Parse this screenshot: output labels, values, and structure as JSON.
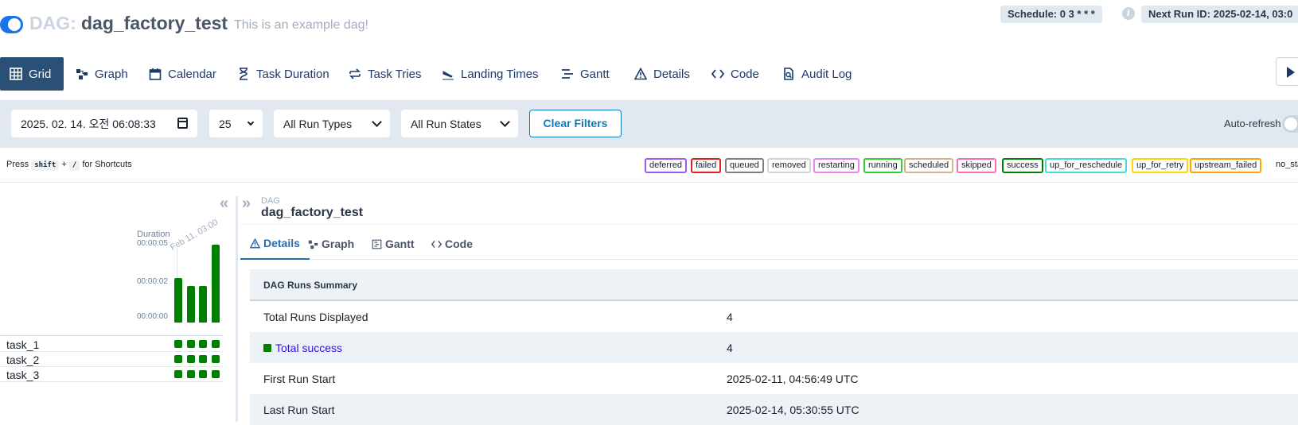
{
  "header": {
    "dag_label": "DAG:",
    "dag_name": "dag_factory_test",
    "description": "This is an example dag!",
    "schedule": "Schedule: 0 3 * * *",
    "next_run": "Next Run ID: 2025-02-14, 03:0",
    "info_glyph": "i"
  },
  "nav": {
    "tabs": [
      {
        "label": "Grid",
        "icon": "grid-icon"
      },
      {
        "label": "Graph",
        "icon": "graph-icon"
      },
      {
        "label": "Calendar",
        "icon": "calendar-icon"
      },
      {
        "label": "Task Duration",
        "icon": "hourglass-icon"
      },
      {
        "label": "Task Tries",
        "icon": "retry-icon"
      },
      {
        "label": "Landing Times",
        "icon": "landing-icon"
      },
      {
        "label": "Gantt",
        "icon": "gantt-icon"
      },
      {
        "label": "Details",
        "icon": "warning-icon"
      },
      {
        "label": "Code",
        "icon": "code-icon"
      },
      {
        "label": "Audit Log",
        "icon": "audit-icon"
      }
    ],
    "active": "Grid"
  },
  "filters": {
    "date": "2025. 02. 14. 오전 06:08:33",
    "limit": "25",
    "run_types": "All Run Types",
    "run_states": "All Run States",
    "clear": "Clear Filters",
    "autorefresh": "Auto-refresh"
  },
  "shortcut": {
    "press": "Press",
    "key1": "shift",
    "plus": "+",
    "key2": "/",
    "suffix": "for Shortcuts"
  },
  "legend": [
    {
      "label": "deferred",
      "color": "#9b59f5"
    },
    {
      "label": "failed",
      "color": "#e02020"
    },
    {
      "label": "queued",
      "color": "#808080"
    },
    {
      "label": "removed",
      "color": "#d3d3d3"
    },
    {
      "label": "restarting",
      "color": "#ee82ee"
    },
    {
      "label": "running",
      "color": "#32cd32"
    },
    {
      "label": "scheduled",
      "color": "#d2b48c"
    },
    {
      "label": "skipped",
      "color": "#ff69b4"
    },
    {
      "label": "success",
      "color": "#008000"
    },
    {
      "label": "up_for_reschedule",
      "color": "#40e0d0"
    },
    {
      "label": "up_for_retry",
      "color": "#ffd700"
    },
    {
      "label": "upstream_failed",
      "color": "#ffa500"
    }
  ],
  "legend_nostatus": "no_sta",
  "grid": {
    "duration_label": "Duration",
    "date_label": "Feb 11, 03:00",
    "ticks": [
      "00:00:05",
      "00:00:02",
      "00:00:00"
    ],
    "run_durations_sec": [
      3.0,
      2.5,
      2.5,
      5.3
    ],
    "tasks": [
      "task_1",
      "task_2",
      "task_3"
    ],
    "collapse_glyph": "«",
    "expand_glyph": "»"
  },
  "details": {
    "crumb_small": "DAG",
    "crumb_title": "dag_factory_test",
    "tabs": [
      "Details",
      "Graph",
      "Gantt",
      "Code"
    ],
    "summary_title": "DAG Runs Summary",
    "rows": [
      {
        "k": "Total Runs Displayed",
        "v": "4"
      },
      {
        "k": "Total success",
        "v": "4"
      },
      {
        "k": "First Run Start",
        "v": "2025-02-11, 04:56:49 UTC"
      },
      {
        "k": "Last Run Start",
        "v": "2025-02-14, 05:30:55 UTC"
      }
    ]
  },
  "colors": {
    "accent": "#2b5075",
    "success": "#008000",
    "link": "#0b7db8"
  }
}
